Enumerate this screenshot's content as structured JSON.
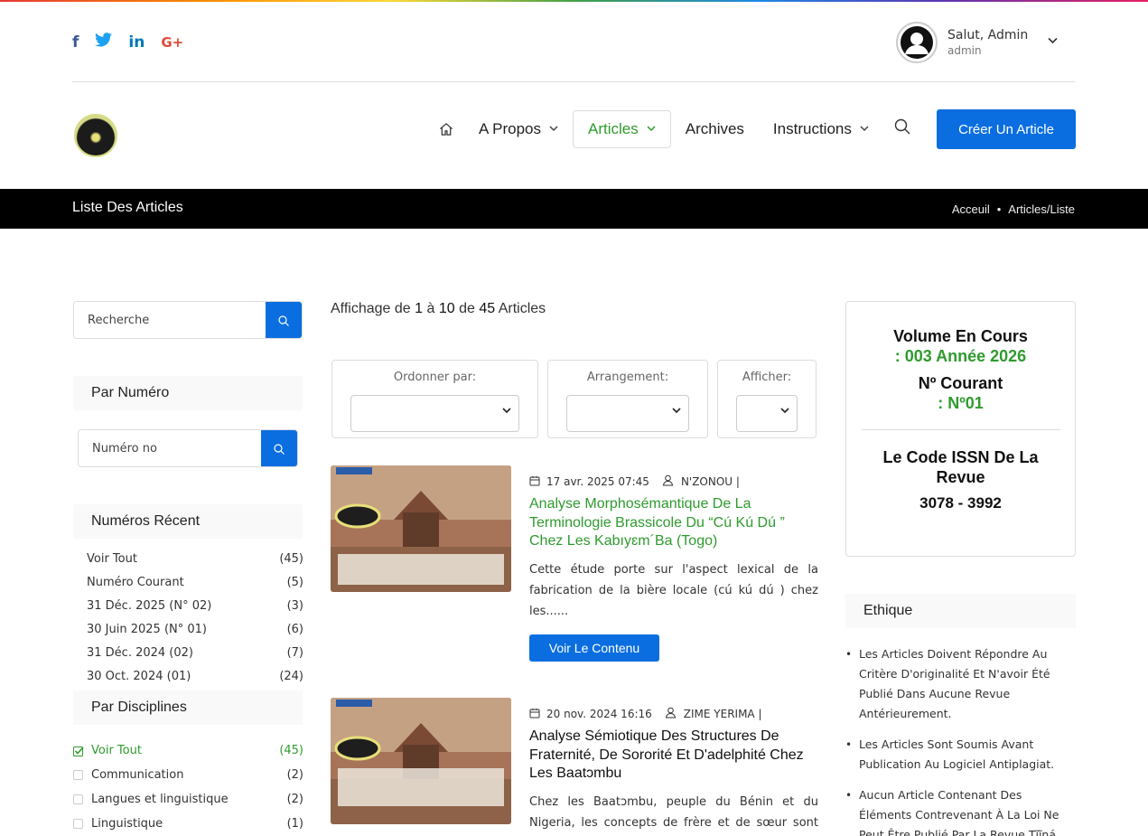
{
  "header": {
    "social": [
      "f",
      "t",
      "in",
      "G+"
    ],
    "user": {
      "greeting": "Salut, Admin",
      "role": "admin"
    }
  },
  "nav": {
    "items": [
      {
        "label": "A Propos"
      },
      {
        "label": "Articles"
      },
      {
        "label": "Archives"
      },
      {
        "label": "Instructions"
      }
    ],
    "create_button": "Créer Un Article"
  },
  "banner": {
    "title": "Liste Des Articles",
    "breadcrumb": [
      "Acceuil",
      "•",
      "Articles/Liste"
    ]
  },
  "sidebar": {
    "search_placeholder": "Recherche",
    "by_number_heading": "Par Numéro",
    "number_placeholder": "Numéro no",
    "recent_heading": "Numéros Récent",
    "recent": [
      {
        "label": "Voir Tout",
        "count": "(45)"
      },
      {
        "label": "Numéro Courant",
        "count": "(5)"
      },
      {
        "label": "31 Déc. 2025 (N° 02)",
        "count": "(3)"
      },
      {
        "label": "30 Juin 2025 (N° 01)",
        "count": "(6)"
      },
      {
        "label": "31 Déc. 2024 (02)",
        "count": "(7)"
      },
      {
        "label": "30 Oct. 2024 (01)",
        "count": "(24)"
      }
    ],
    "disciplines_heading": "Par Disciplines",
    "disciplines": [
      {
        "label": "Voir Tout",
        "count": "(45)",
        "checked": true
      },
      {
        "label": "Communication",
        "count": "(2)",
        "checked": false
      },
      {
        "label": "Langues et linguistique",
        "count": "(2)",
        "checked": false
      },
      {
        "label": "Linguistique",
        "count": "(1)",
        "checked": false
      }
    ]
  },
  "main": {
    "display": {
      "prefix": "Affichage de",
      "from": "1",
      "to_word": "à",
      "to": "10",
      "of_word": "de",
      "total": "45",
      "suffix": "Articles"
    },
    "filters": {
      "order": "Ordonner par:",
      "arrange": "Arrangement:",
      "show": "Afficher:"
    },
    "articles": [
      {
        "date": "17 avr. 2025 07:45",
        "author": "N'ZONOU |",
        "title_lines": [
          "Analyse Morphosémantique De La",
          "Terminologie Brassicole Du “Cú Kú Dú ”",
          "Chez Les Kabıyɛm´Ba (Togo)"
        ],
        "excerpt_lines": [
          "Cette étude porte sur l'aspect lexical de la",
          "fabrication de la bière locale (cú kú dú ) chez",
          "les......"
        ],
        "button": "Voir Le Contenu"
      },
      {
        "date": "20 nov. 2024 16:16",
        "author": "ZIME YERIMA |",
        "title_lines": [
          "Analyse Sémiotique Des Structures De",
          "Fraternité, De Sororité Et D'adelphité Chez",
          "Les Baatɔmbu"
        ],
        "excerpt_lines": [
          "Chez les Baatɔmbu, peuple du Bénin et du",
          "Nigeria, les concepts de frère et de sœur sont"
        ]
      }
    ]
  },
  "right": {
    "volume_label": "Volume En Cours",
    "volume_value": ": 003 Année 2026",
    "current_label": "Nº Courant",
    "current_value": ": Nº01",
    "issn_label_1": "Le Code ISSN De La",
    "issn_label_2": "Revue",
    "issn_value": "3078 - 3992",
    "ethics_heading": "Ethique",
    "ethics": [
      {
        "lines": [
          "Les Articles Doivent Répondre Au",
          "Critère D'originalité Et N'avoir Été",
          "Publié Dans Aucune Revue",
          "Antérieurement."
        ]
      },
      {
        "lines": [
          "Les Articles Sont Soumis Avant",
          "Publication Au Logiciel Antiplagiat."
        ]
      },
      {
        "lines": [
          "Aucun Article Contenant Des",
          "Éléments Contrevenant À La Loi Ne",
          "Peut Être Publié Par La Revue Tĩĩŋá."
        ]
      }
    ]
  },
  "colors": {
    "accent": "#0b6ee0",
    "green": "#2e9b2e"
  },
  "icons": [
    "facebook-icon",
    "twitter-icon",
    "linkedin-icon",
    "google-plus-icon",
    "user-avatar-icon",
    "chevron-down-icon",
    "home-icon",
    "search-icon",
    "calendar-icon",
    "user-icon",
    "checkbox-icon"
  ]
}
